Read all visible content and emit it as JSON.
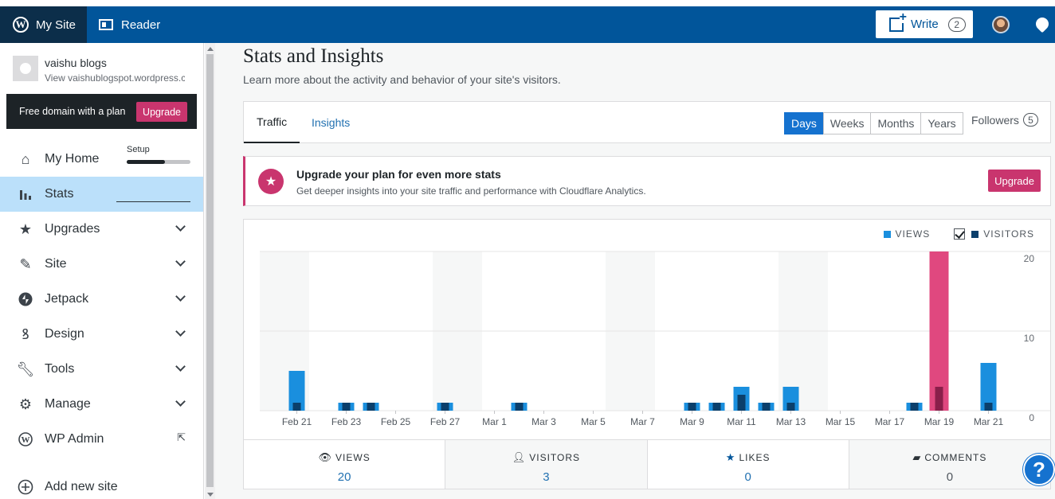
{
  "topbar": {
    "my_site_label": "My Site",
    "reader_label": "Reader",
    "write_label": "Write",
    "write_count": "2",
    "wp_logo_glyph": "W"
  },
  "sidebar": {
    "site_name": "vaishu blogs",
    "site_url": "View vaishublogspot.wordpress.com",
    "domain_banner_text": "Free domain with a plan",
    "domain_upgrade_label": "Upgrade",
    "setup_label": "Setup",
    "setup_progress": 0.6,
    "items": [
      {
        "label": "My Home",
        "icon": "home-icon"
      },
      {
        "label": "Stats",
        "icon": "stats-icon"
      },
      {
        "label": "Upgrades",
        "icon": "star-icon"
      },
      {
        "label": "Site",
        "icon": "pencil-icon"
      },
      {
        "label": "Jetpack",
        "icon": "jetpack-icon"
      },
      {
        "label": "Design",
        "icon": "design-icon"
      },
      {
        "label": "Tools",
        "icon": "wrench-icon"
      },
      {
        "label": "Manage",
        "icon": "gear-icon"
      },
      {
        "label": "WP Admin",
        "icon": "wordpress-icon"
      },
      {
        "label": "Add new site",
        "icon": "plus-circle-icon"
      }
    ]
  },
  "main": {
    "title": "Stats and Insights",
    "subtitle": "Learn more about the activity and behavior of your site's visitors.",
    "tabs": [
      {
        "label": "Traffic"
      },
      {
        "label": "Insights"
      }
    ],
    "periods": [
      "Days",
      "Weeks",
      "Months",
      "Years"
    ],
    "selected_period": "Days",
    "followers_label": "Followers",
    "followers_count": "5",
    "upgrade_notice": {
      "title": "Upgrade your plan for even more stats",
      "description": "Get deeper insights into your site traffic and performance with Cloudflare Analytics.",
      "button": "Upgrade"
    },
    "legend": {
      "views": "VIEWS",
      "visitors": "VISITORS"
    },
    "summary": [
      {
        "label": "VIEWS",
        "value": "20",
        "icon": "eye-icon"
      },
      {
        "label": "VISITORS",
        "value": "3",
        "icon": "person-icon"
      },
      {
        "label": "LIKES",
        "value": "0",
        "icon": "star-icon"
      },
      {
        "label": "COMMENTS",
        "value": "0",
        "icon": "comment-icon"
      }
    ],
    "help_label": "?"
  },
  "colors": {
    "brand": "#01559a",
    "accent_pink": "#c9356e",
    "views": "#1a8fde",
    "visitors": "#0b3f6b",
    "highlight": "#e0487f"
  },
  "chart_data": {
    "type": "bar",
    "categories": [
      "Feb 20",
      "Feb 21",
      "Feb 22",
      "Feb 23",
      "Feb 24",
      "Feb 25",
      "Feb 26",
      "Feb 27",
      "Feb 28",
      "Mar 1",
      "Mar 2",
      "Mar 3",
      "Mar 4",
      "Mar 5",
      "Mar 6",
      "Mar 7",
      "Mar 8",
      "Mar 9",
      "Mar 10",
      "Mar 11",
      "Mar 12",
      "Mar 13",
      "Mar 14",
      "Mar 15",
      "Mar 16",
      "Mar 17",
      "Mar 18",
      "Mar 19",
      "Mar 20",
      "Mar 21"
    ],
    "tick_labels": [
      "Feb 21",
      "Feb 23",
      "Feb 25",
      "Feb 27",
      "Mar 1",
      "Mar 3",
      "Mar 5",
      "Mar 7",
      "Mar 9",
      "Mar 11",
      "Mar 13",
      "Mar 15",
      "Mar 17",
      "Mar 19",
      "Mar 21"
    ],
    "series": [
      {
        "name": "VIEWS",
        "values": [
          0,
          5,
          0,
          1,
          1,
          0,
          0,
          1,
          0,
          0,
          1,
          0,
          0,
          0,
          0,
          0,
          0,
          1,
          1,
          3,
          1,
          3,
          0,
          0,
          0,
          0,
          1,
          20,
          0,
          6
        ]
      },
      {
        "name": "VISITORS",
        "values": [
          0,
          1,
          0,
          1,
          1,
          0,
          0,
          1,
          0,
          0,
          1,
          0,
          0,
          0,
          0,
          0,
          0,
          1,
          1,
          2,
          1,
          1,
          0,
          0,
          0,
          0,
          1,
          3,
          0,
          1
        ]
      }
    ],
    "highlighted": "Mar 19",
    "ylim": [
      0,
      20
    ],
    "yticks": [
      0,
      10,
      20
    ],
    "shaded_weekends": [
      "Feb 20",
      "Feb 27",
      "Mar 6",
      "Mar 13"
    ]
  }
}
